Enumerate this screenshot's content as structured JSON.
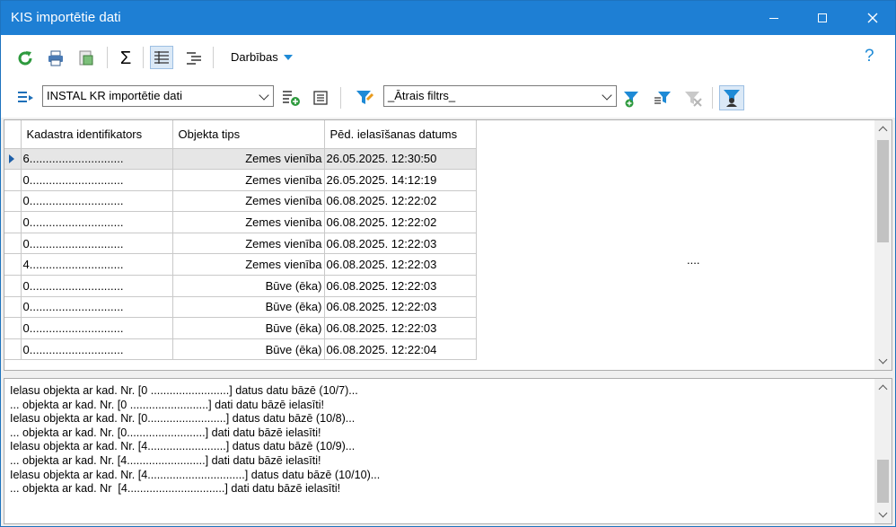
{
  "window": {
    "title": "KIS importētie dati"
  },
  "toolbar": {
    "actions_label": "Darbības",
    "help_label": "?",
    "sum_label": "Σ"
  },
  "filter_bar": {
    "view_select_value": "INSTAL KR importētie dati",
    "quick_filter_value": "_Ātrais filtrs_"
  },
  "grid": {
    "columns": [
      "Kadastra identifikators",
      "Objekta tips",
      "Pēd. ielasīšanas datums"
    ],
    "rows": [
      {
        "id": "6.............................",
        "type": "Zemes vienība",
        "date": "26.05.2025. 12:30:50"
      },
      {
        "id": "0.............................",
        "type": "Zemes vienība",
        "date": "26.05.2025. 14:12:19"
      },
      {
        "id": "0.............................",
        "type": "Zemes vienība",
        "date": "06.08.2025. 12:22:02"
      },
      {
        "id": "0.............................",
        "type": "Zemes vienība",
        "date": "06.08.2025. 12:22:02"
      },
      {
        "id": "0.............................",
        "type": "Zemes vienība",
        "date": "06.08.2025. 12:22:03"
      },
      {
        "id": "4.............................",
        "type": "Zemes vienība",
        "date": "06.08.2025. 12:22:03"
      },
      {
        "id": "0.............................",
        "type": "Būve (ēka)",
        "date": "06.08.2025. 12:22:03"
      },
      {
        "id": "0.............................",
        "type": "Būve (ēka)",
        "date": "06.08.2025. 12:22:03"
      },
      {
        "id": "0.............................",
        "type": "Būve (ēka)",
        "date": "06.08.2025. 12:22:03"
      },
      {
        "id": "0.............................",
        "type": "Būve (ēka)",
        "date": "06.08.2025. 12:22:04"
      }
    ],
    "side_ellipsis": "...."
  },
  "log": {
    "lines": [
      "Ielasu objekta ar kad. Nr. [0 .........................] datus datu bāzē (10/7)...",
      "... objekta ar kad. Nr. [0 .........................] dati datu bāzē ielasīti!",
      "Ielasu objekta ar kad. Nr. [0.........................] datus datu bāzē (10/8)...",
      "... objekta ar kad. Nr. [0.........................] dati datu bāzē ielasīti!",
      "Ielasu objekta ar kad. Nr. [4.........................] datus datu bāzē (10/9)...",
      "... objekta ar kad. Nr. [4.........................] dati datu bāzē ielasīti!",
      "Ielasu objekta ar kad. Nr. [4...............................] datus datu bāzē (10/10)...",
      "... objekta ar kad. Nr  [4...............................] dati datu bāzē ielasīti!"
    ]
  },
  "colors": {
    "titlebar": "#1e7fd4",
    "accent": "#1e8ad6",
    "selected_row": "#e6e6e6"
  }
}
